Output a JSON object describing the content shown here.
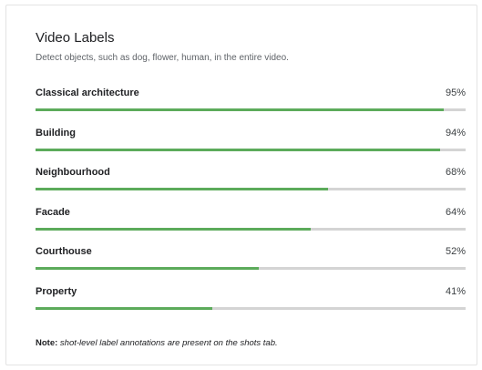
{
  "panel": {
    "title": "Video Labels",
    "subtitle": "Detect objects, such as dog, flower, human, in the entire video."
  },
  "labels": [
    {
      "name": "Classical architecture",
      "percent_text": "95%",
      "confidence": 0.95
    },
    {
      "name": "Building",
      "percent_text": "94%",
      "confidence": 0.94
    },
    {
      "name": "Neighbourhood",
      "percent_text": "68%",
      "confidence": 0.68
    },
    {
      "name": "Facade",
      "percent_text": "64%",
      "confidence": 0.64
    },
    {
      "name": "Courthouse",
      "percent_text": "52%",
      "confidence": 0.52
    },
    {
      "name": "Property",
      "percent_text": "41%",
      "confidence": 0.41
    }
  ],
  "note": {
    "prefix": "Note:",
    "text": "shot-level label annotations are present on the shots tab."
  },
  "colors": {
    "bar_fill": "#5cab5b",
    "bar_track": "#d4d4d4"
  }
}
